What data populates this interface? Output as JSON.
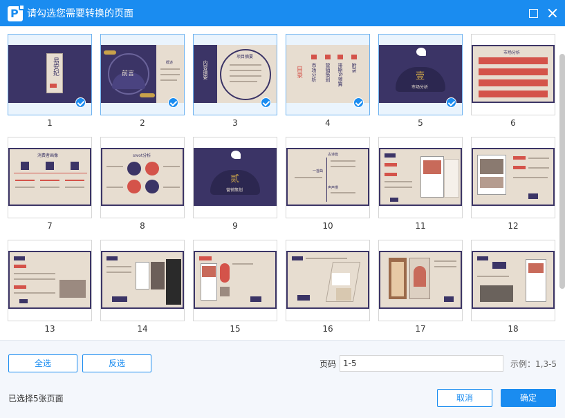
{
  "window": {
    "title": "请勾选您需要转换的页面"
  },
  "pages": [
    {
      "number": "1",
      "selected": true
    },
    {
      "number": "2",
      "selected": true
    },
    {
      "number": "3",
      "selected": true
    },
    {
      "number": "4",
      "selected": true
    },
    {
      "number": "5",
      "selected": true
    },
    {
      "number": "6",
      "selected": false
    },
    {
      "number": "7",
      "selected": false
    },
    {
      "number": "8",
      "selected": false
    },
    {
      "number": "9",
      "selected": false
    },
    {
      "number": "10",
      "selected": false
    },
    {
      "number": "11",
      "selected": false
    },
    {
      "number": "12",
      "selected": false
    },
    {
      "number": "13",
      "selected": false
    },
    {
      "number": "14",
      "selected": false
    },
    {
      "number": "15",
      "selected": false
    },
    {
      "number": "16",
      "selected": false
    },
    {
      "number": "17",
      "selected": false
    },
    {
      "number": "18",
      "selected": false
    }
  ],
  "slides": {
    "s1": {
      "title": "易安妃"
    },
    "s2": {
      "title": "前言",
      "side": "概述"
    },
    "s3": {
      "left": "内容摘要",
      "head": "项目摘要"
    },
    "s4": {
      "heading": "目录",
      "items": [
        "市场分析",
        "营销策划",
        "排期&预算",
        "附录"
      ]
    },
    "s5": {
      "numeral": "壹",
      "subtitle": "市场分析"
    },
    "s6": {
      "head": "市场分析"
    },
    "s7": {
      "head": "消费者画像"
    },
    "s8": {
      "head": "swot分析"
    },
    "s9": {
      "numeral": "贰",
      "subtitle": "营销策划"
    },
    "s10": {
      "a": "古诗篇",
      "b": "一首曲",
      "c": "声声慢"
    }
  },
  "footer": {
    "select_all": "全选",
    "invert": "反选",
    "page_label": "页码",
    "page_value": "1-5",
    "example": "示例：1,3-5",
    "selected_count": "已选择5张页面",
    "cancel": "取消",
    "confirm": "确定"
  },
  "colors": {
    "accent": "#1a8cf0",
    "slide_navy": "#3b3466",
    "slide_cream": "#e7ddd0",
    "slide_red": "#d4534a"
  }
}
